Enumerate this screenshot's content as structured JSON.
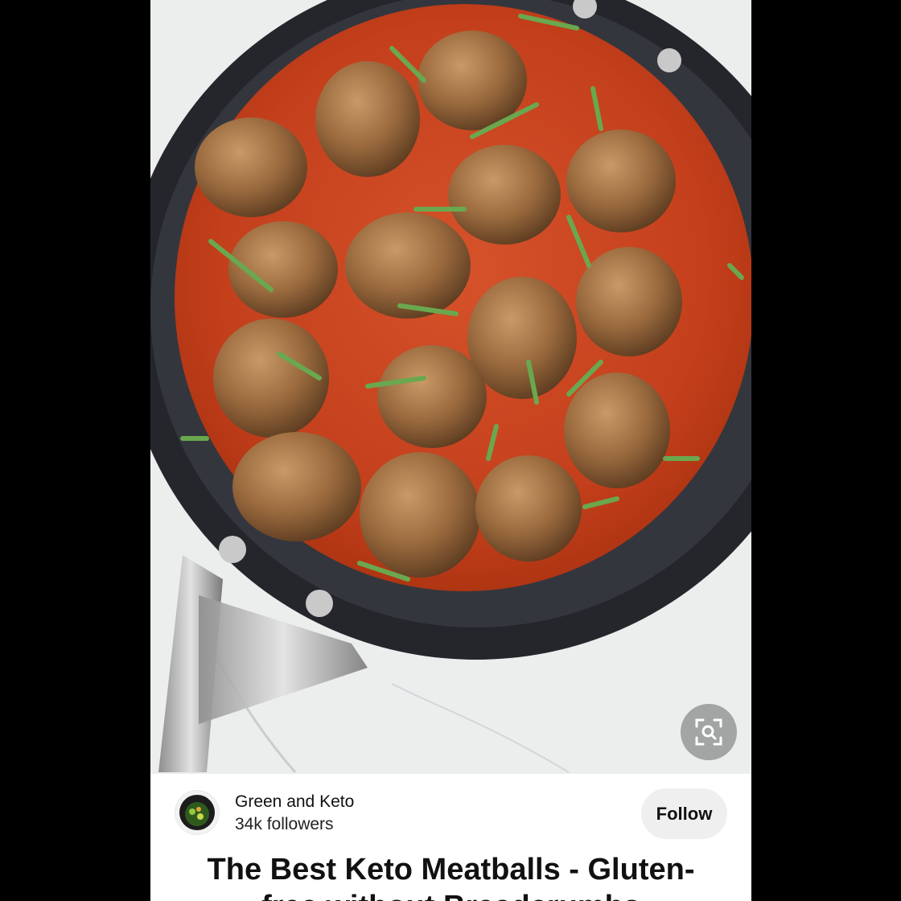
{
  "pin": {
    "image_alt": "Keto meatballs in tomato sauce in a skillet",
    "title": "The Best Keto Meatballs - Gluten-",
    "title_cont": "free without Breadcrumbs"
  },
  "creator": {
    "name": "Green and Keto",
    "followers": "34k followers"
  },
  "actions": {
    "follow_label": "Follow",
    "visual_search_icon": "visual-search-icon"
  },
  "colors": {
    "sauce": "#c8431f",
    "pan": "#2b2d33",
    "follow_bg": "#efefef"
  }
}
